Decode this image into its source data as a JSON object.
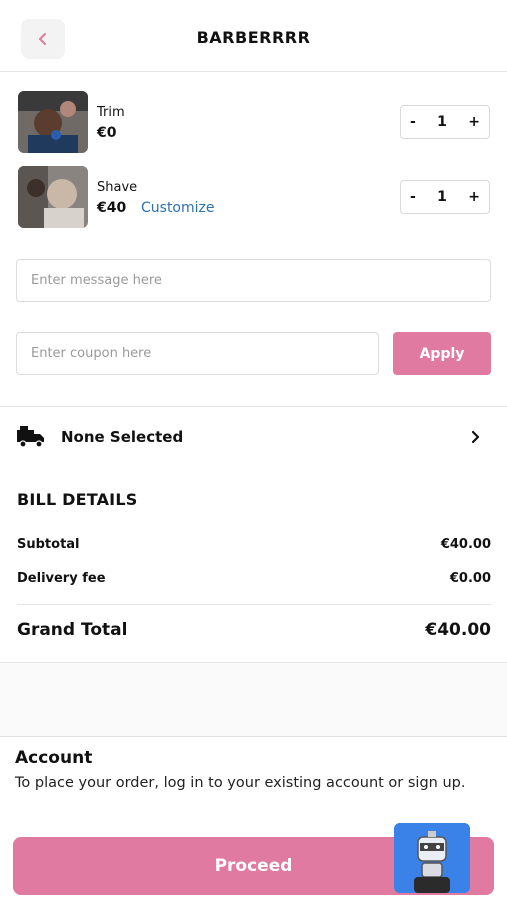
{
  "header": {
    "title": "BARBERRRR"
  },
  "items": [
    {
      "name": "Trim",
      "price": "€0",
      "qty": "1",
      "minus": "-",
      "plus": "+"
    },
    {
      "name": "Shave",
      "price": "€40",
      "qty": "1",
      "minus": "-",
      "plus": "+",
      "customize_label": "Customize"
    }
  ],
  "message": {
    "placeholder": "Enter message here"
  },
  "coupon": {
    "placeholder": "Enter coupon here",
    "apply_label": "Apply"
  },
  "delivery": {
    "label": "None Selected"
  },
  "bill": {
    "title": "BILL DETAILS",
    "subtotal_label": "Subtotal",
    "subtotal_value": "€40.00",
    "delivery_label": "Delivery fee",
    "delivery_value": "€0.00",
    "total_label": "Grand Total",
    "total_value": "€40.00"
  },
  "account": {
    "title": "Account",
    "text": "To place your order, log in to your existing account or sign up."
  },
  "proceed_label": "Proceed",
  "colors": {
    "accent": "#e07aa0",
    "link": "#2d6fb3",
    "chat": "#3a82e8"
  }
}
